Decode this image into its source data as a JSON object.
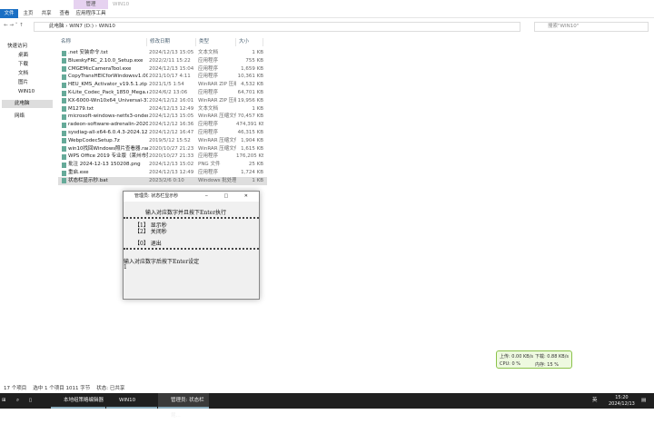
{
  "window": {
    "title": "WIN10",
    "context_tab": "管理"
  },
  "ribbon": {
    "tabs": [
      "文件",
      "主页",
      "共享",
      "查看",
      "应用程序工具"
    ]
  },
  "address": {
    "crumbs": "此电脑 › WIN7 (D:) › WIN10",
    "search_placeholder": "搜索\"WIN10\""
  },
  "sidebar": {
    "items": [
      "快速访问",
      "桌面",
      "下载",
      "文档",
      "图片",
      "WIN10",
      "此电脑",
      "网络"
    ]
  },
  "columns": [
    "名称",
    "修改日期",
    "类型",
    "大小"
  ],
  "files": [
    {
      "name": ".net 安装命令.txt",
      "date": "2024/12/13 15:05",
      "type": "文本文档",
      "size": "1 KB"
    },
    {
      "name": "BlueskyFRC_2.10.0_Setup.exe",
      "date": "2022/2/11 15:22",
      "type": "应用程序",
      "size": "755 KB"
    },
    {
      "name": "CMGEMicCameraTool.exe",
      "date": "2024/12/13 15:04",
      "type": "应用程序",
      "size": "1,659 KB"
    },
    {
      "name": "CopyTransHEICforWindowsv1.009.exe",
      "date": "2021/10/17 4:11",
      "type": "应用程序",
      "size": "10,361 KB"
    },
    {
      "name": "HEU_KMS_Activator_v19.5.1.zip",
      "date": "2021/1/5 1:54",
      "type": "WinRAR ZIP 压缩...",
      "size": "4,532 KB"
    },
    {
      "name": "K-Lite_Codec_Pack_1850_Mega.exe",
      "date": "2024/6/2 13:06",
      "type": "应用程序",
      "size": "64,701 KB"
    },
    {
      "name": "KX-6000-Win10x64_Universal-37.00.4...",
      "date": "2024/12/12 16:01",
      "type": "WinRAR ZIP 压缩...",
      "size": "19,956 KB"
    },
    {
      "name": "M1279.txt",
      "date": "2024/12/13 12:49",
      "type": "文本文档",
      "size": "1 KB"
    },
    {
      "name": "microsoft-windows-netfx3-ondeman...",
      "date": "2024/12/13 15:05",
      "type": "WinRAR 压缩文件",
      "size": "70,457 KB"
    },
    {
      "name": "radeon-software-adrenalin-2020-22....",
      "date": "2024/12/12 16:36",
      "type": "应用程序",
      "size": "474,391 KB"
    },
    {
      "name": "sysdiag-all-x64-6.0.4.3-2024.12.11.1.e...",
      "date": "2024/12/12 16:47",
      "type": "应用程序",
      "size": "46,315 KB"
    },
    {
      "name": "WebpCodecSetup.7z",
      "date": "2019/5/12 15:52",
      "type": "WinRAR 压缩文件",
      "size": "1,904 KB"
    },
    {
      "name": "win10找回Windows照片查看器.rar",
      "date": "2020/10/27 21:23",
      "type": "WinRAR 压缩文件",
      "size": "1,615 KB"
    },
    {
      "name": "WPS Office 2019 专业版（莱州市莞邑...",
      "date": "2020/10/27 21:33",
      "type": "应用程序",
      "size": "176,205 KB"
    },
    {
      "name": "批注 2024-12-13 150208.png",
      "date": "2024/12/13 15:02",
      "type": "PNG 文件",
      "size": "25 KB"
    },
    {
      "name": "重启.exe",
      "date": "2024/12/13 12:49",
      "type": "应用程序",
      "size": "1,724 KB"
    },
    {
      "name": "状态栏显示秒.bat",
      "date": "2023/2/6 0:10",
      "type": "Windows 批处理...",
      "size": "1 KB"
    }
  ],
  "status": {
    "count": "17 个项目",
    "selected": "选中 1 个项目  1011 字节",
    "state": "状态: 已共享"
  },
  "console": {
    "title": "管理员:  状态栏显示秒",
    "prompt": "输入对应数字并且按下Enter执行",
    "opt1": "【1】 显示秒",
    "opt2": "【2】 关闭秒",
    "opt0": "【0】 退出",
    "ask": "输入对应数字后按下Enter设定",
    "input": "1"
  },
  "netmon": {
    "up": "上传: 0.00 KB/s",
    "down": "下载: 0.88 KB/s",
    "cpu": "CPU: 0 %",
    "mem": "内存: 15 %"
  },
  "taskbar": {
    "apps": [
      "本地组策略编辑器",
      "WIN10",
      "管理员:  状态栏昆..."
    ],
    "time": "15:20",
    "date": "2024/12/13",
    "ime": "英"
  }
}
